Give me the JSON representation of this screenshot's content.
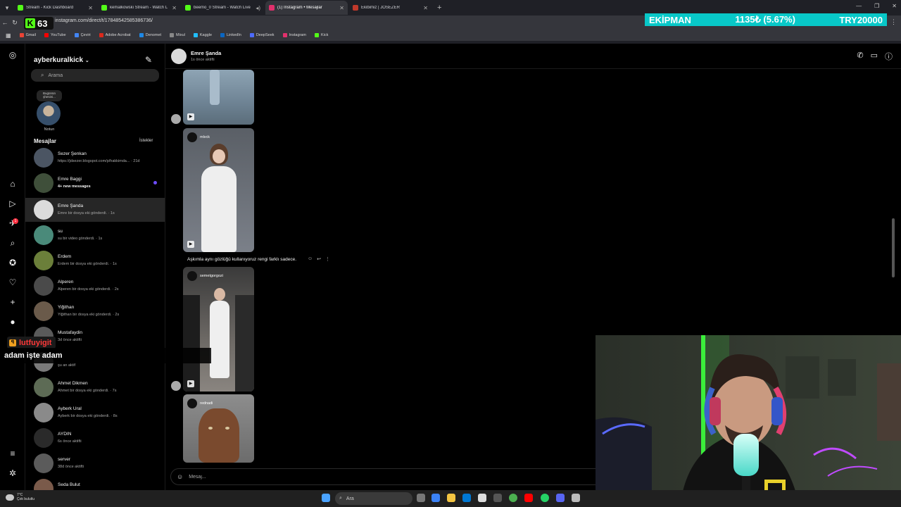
{
  "browser": {
    "tabs": [
      {
        "title": "Stream - Kick Dashboard",
        "color": "#53fc18",
        "active": false
      },
      {
        "title": "kemalkowski Stream - Watch L",
        "color": "#53fc18",
        "active": false
      },
      {
        "title": "beemo_0 Stream - Watch Live",
        "color": "#53fc18",
        "active": false
      },
      {
        "title": "(1) Instagram • Mesajlar",
        "color": "#e1306c",
        "active": true
      },
      {
        "title": "Ekibimiz | JOSEZER",
        "color": "#c0392b",
        "active": false
      }
    ],
    "new_tab": "+",
    "url": "instagram.com/direct/t/17848542585386736/",
    "logo_number": "63",
    "bookmarks": [
      {
        "label": "Gmail",
        "color": "#ea4335"
      },
      {
        "label": "YouTube",
        "color": "#ff0000"
      },
      {
        "label": "Çeviri",
        "color": "#4285f4"
      },
      {
        "label": "Adobe Acrobat",
        "color": "#d9291c"
      },
      {
        "label": "Denomet",
        "color": "#1e88e5"
      },
      {
        "label": "Mixul",
        "color": "#888888"
      },
      {
        "label": "Kaggle",
        "color": "#20beff"
      },
      {
        "label": "LinkedIn",
        "color": "#0a66c2"
      },
      {
        "label": "DeepSeek",
        "color": "#4d6bfe"
      },
      {
        "label": "Instagram",
        "color": "#e1306c"
      },
      {
        "label": "Kick",
        "color": "#53fc18"
      }
    ]
  },
  "ticker": {
    "left": "EKİPMAN",
    "value": "1135₺ (5.67%)",
    "right": "TRY20000"
  },
  "instagram": {
    "username": "ayberkuralkick",
    "search_placeholder": "Arama",
    "note": {
      "bubble": "Bugünün şhesini...",
      "caption": "Notun"
    },
    "messages_title": "Mesajlar",
    "requests_label": "İstekler",
    "conversations": [
      {
        "name": "Sezer Şenkan",
        "preview": "https://jdsezer.blogspot.com/p/hakkimda... · 21d",
        "bold": false,
        "unread": false,
        "active": false
      },
      {
        "name": "Emre Baggi",
        "preview": "4+ new messages",
        "bold": true,
        "unread": true,
        "active": false
      },
      {
        "name": "Emre Şanda",
        "preview": "Emre bir dosya eki gönderdi. · 1s",
        "bold": false,
        "unread": false,
        "active": true
      },
      {
        "name": "su",
        "preview": "su bir video gönderdi. · 1s",
        "bold": false,
        "unread": false,
        "active": false
      },
      {
        "name": "Erdem",
        "preview": "Erdem bir dosya eki gönderdi. · 1s",
        "bold": false,
        "unread": false,
        "active": false
      },
      {
        "name": "Alperen",
        "preview": "Alperen bir dosya eki gönderdi. · 2s",
        "bold": false,
        "unread": false,
        "active": false
      },
      {
        "name": "Yiğithan",
        "preview": "Yiğithan bir dosya eki gönderdi. · 2s",
        "bold": false,
        "unread": false,
        "active": false
      },
      {
        "name": "Mustafaydin",
        "preview": "3d önce aktifti",
        "bold": false,
        "unread": false,
        "active": false
      },
      {
        "name": "",
        "preview": "şu an aktif",
        "bold": false,
        "unread": false,
        "active": false
      },
      {
        "name": "Ahmet Dikmen",
        "preview": "Ahmet bir dosya eki gönderdi. · 7s",
        "bold": false,
        "unread": false,
        "active": false
      },
      {
        "name": "Ayberk Ural",
        "preview": "Ayberk bir dosya eki gönderdi. · 8s",
        "bold": false,
        "unread": false,
        "active": false
      },
      {
        "name": "AYDIN",
        "preview": "6s önce aktifti",
        "bold": false,
        "unread": false,
        "active": false
      },
      {
        "name": "server",
        "preview": "38d önce aktifti",
        "bold": false,
        "unread": false,
        "active": false
      },
      {
        "name": "Seda Bulut",
        "preview": "",
        "bold": false,
        "unread": false,
        "active": false
      }
    ],
    "chat": {
      "name": "Emre Şanda",
      "status": "1s önce aktifti",
      "media_handles": [
        "mlvck",
        "semetgorgozi",
        "rednadi"
      ],
      "caption": "Aşkımla aynı gözlüğü kullanıyoruz rengi farklı sadece.",
      "composer_placeholder": "Mesaj..."
    },
    "notification_count": "1"
  },
  "stream_chat": {
    "username": "lutfuyigit",
    "message": "adam işte adam"
  },
  "taskbar": {
    "temp": "7°C",
    "weather": "Çok bulutlu",
    "search_placeholder": "Ara"
  }
}
